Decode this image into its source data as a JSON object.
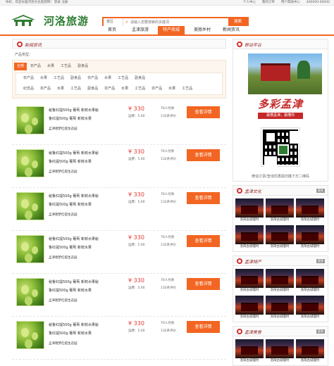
{
  "topbar": {
    "welcome": "你好，欢迎光临河洛文化旅游网！ 登录 注册",
    "links": [
      "个人中心",
      "我的订单",
      "用户帮助中心",
      "400000-00000"
    ]
  },
  "header": {
    "brand": "河洛旅游",
    "brand_sub": "Heluoyinweng tourism",
    "search_category": "景区",
    "search_placeholder": "请输入您要搜索的关键词",
    "search_button": "搜索"
  },
  "nav": {
    "items": [
      "首页",
      "孟津旅游",
      "特产商城",
      "美丽乡村",
      "新闻资讯"
    ],
    "active_index": 2
  },
  "main": {
    "section_title": "新闻资讯",
    "product_type_label": "产品类型：",
    "top_categories": [
      "全部",
      "农产品",
      "水果",
      "工艺品",
      "副食品"
    ],
    "sub_rows": [
      [
        "农产品",
        "水果",
        "工艺品",
        "副食品",
        "农产品",
        "水果",
        "工艺品",
        "副食品"
      ],
      [
        "纪念品",
        "农产品",
        "水果",
        "工艺品",
        "副食品",
        "农产品",
        "水果",
        "工艺品",
        "农产品",
        "水果",
        "工艺品"
      ]
    ],
    "products": [
      {
        "name": "秘鲁红提500g 葡萄 新鲜水果秘鲁红提500g 葡萄 新鲜水果",
        "origin": "孟津德梦红提生态园",
        "price": "¥ 330",
        "shipping": "运费：5.00",
        "buyers": "76人付款",
        "evals": "132条评价",
        "detail": "查看详情"
      },
      {
        "name": "秘鲁红提500g 葡萄 新鲜水果秘鲁红提500g 葡萄 新鲜水果",
        "origin": "孟津德梦红提生态园",
        "price": "¥ 330",
        "shipping": "运费：5.00",
        "buyers": "76人付款",
        "evals": "132条评价",
        "detail": "查看详情"
      },
      {
        "name": "秘鲁红提500g 葡萄 新鲜水果秘鲁红提500g 葡萄 新鲜水果",
        "origin": "孟津德梦红提生态园",
        "price": "¥ 330",
        "shipping": "运费：5.00",
        "buyers": "76人付款",
        "evals": "132条评价",
        "detail": "查看详情"
      },
      {
        "name": "秘鲁红提500g 葡萄 新鲜水果秘鲁红提500g 葡萄 新鲜水果",
        "origin": "孟津德梦红提生态园",
        "price": "¥ 330",
        "shipping": "运费：5.00",
        "buyers": "76人付款",
        "evals": "132条评价",
        "detail": "查看详情"
      },
      {
        "name": "秘鲁红提500g 葡萄 新鲜水果秘鲁红提500g 葡萄 新鲜水果",
        "origin": "孟津德梦红提生态园",
        "price": "¥ 330",
        "shipping": "运费：5.00",
        "buyers": "76人付款",
        "evals": "132条评价",
        "detail": "查看详情"
      },
      {
        "name": "秘鲁红提500g 葡萄 新鲜水果秘鲁红提500g 葡萄 新鲜水果",
        "origin": "孟津德梦红提生态园",
        "price": "¥ 330",
        "shipping": "运费：5.00",
        "buyers": "76人付款",
        "evals": "132条评价",
        "detail": "查看详情"
      }
    ]
  },
  "side": {
    "promo_title": "移动平台",
    "slogan": "多彩孟津",
    "slogan2": "最慢孟津，最懂你",
    "qr_caption": "微信订票/查询优惠需扫描下方二维码",
    "galleries": [
      {
        "title": "孟津文化",
        "more": "更多",
        "items": [
          "洛阳古城慢时",
          "洛阳古城慢时",
          "洛阳古城慢时",
          "洛阳古城慢时",
          "洛阳古城慢时",
          "洛阳古城慢时"
        ]
      },
      {
        "title": "孟津特产",
        "more": "更多",
        "items": [
          "洛阳古城慢时",
          "洛阳古城慢时",
          "洛阳古城慢时",
          "洛阳古城慢时",
          "洛阳古城慢时",
          "洛阳古城慢时"
        ]
      },
      {
        "title": "孟津美食",
        "more": "更多",
        "items": [
          "洛阳古城慢时",
          "洛阳古城慢时",
          "洛阳古城慢时",
          "洛阳古城慢时",
          "洛阳古城慢时",
          "洛阳古城慢时"
        ]
      }
    ]
  },
  "colors": {
    "accent": "#f26522",
    "price": "#e53935",
    "brand": "#2e7d32",
    "title": "#8b1a1a"
  }
}
